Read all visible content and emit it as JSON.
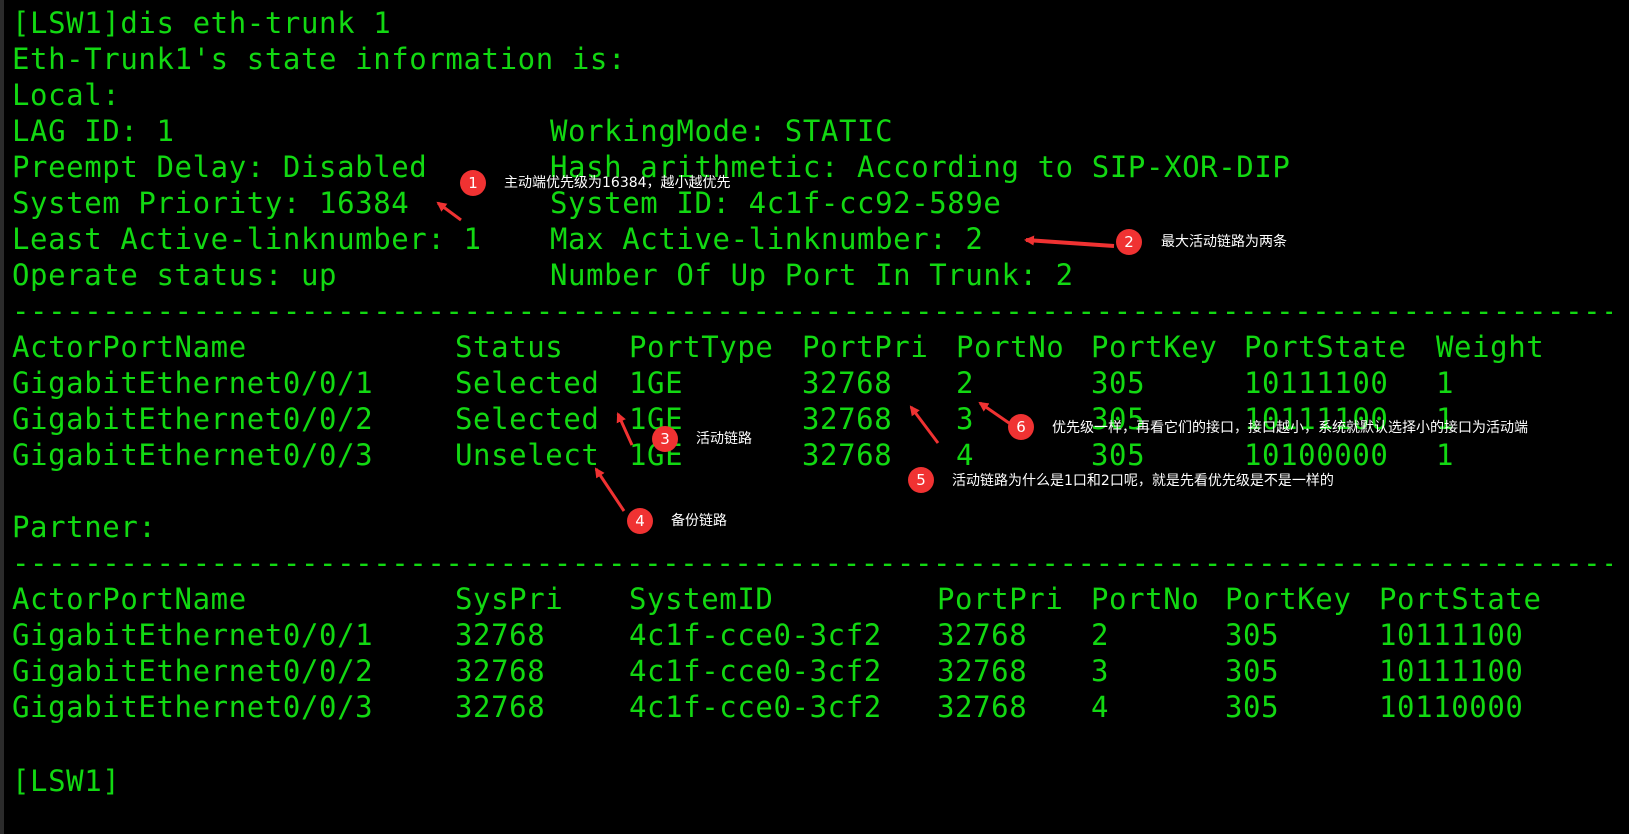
{
  "terminal": {
    "command_line": "[LSW1]dis eth-trunk 1",
    "state_title": "Eth-Trunk1's state information is:",
    "local_label": "Local:",
    "left_info": [
      "LAG ID: 1",
      "Preempt Delay: Disabled",
      "System Priority: 16384",
      "Least Active-linknumber: 1",
      "Operate status: up"
    ],
    "right_info": [
      "WorkingMode: STATIC",
      "Hash arithmetic: According to SIP-XOR-DIP",
      "System ID: 4c1f-cc92-589e",
      "Max Active-linknumber: 2",
      "Number Of Up Port In Trunk: 2"
    ],
    "separator": "--------------------------------------------------------------------------------------------------------------",
    "local_table": {
      "headers": [
        "ActorPortName",
        "Status",
        "PortType",
        "PortPri",
        "PortNo",
        "PortKey",
        "PortState",
        "Weight"
      ],
      "rows": [
        [
          "GigabitEthernet0/0/1",
          "Selected",
          "1GE",
          "32768",
          "2",
          "305",
          "10111100",
          "1"
        ],
        [
          "GigabitEthernet0/0/2",
          "Selected",
          "1GE",
          "32768",
          "3",
          "305",
          "10111100",
          "1"
        ],
        [
          "GigabitEthernet0/0/3",
          "Unselect",
          "1GE",
          "32768",
          "4",
          "305",
          "10100000",
          "1"
        ]
      ]
    },
    "partner_label": "Partner:",
    "partner_table": {
      "headers": [
        "ActorPortName",
        "SysPri",
        "SystemID",
        "PortPri",
        "PortNo",
        "PortKey",
        "PortState"
      ],
      "rows": [
        [
          "GigabitEthernet0/0/1",
          "32768",
          "4c1f-cce0-3cf2",
          "32768",
          "2",
          "305",
          "10111100"
        ],
        [
          "GigabitEthernet0/0/2",
          "32768",
          "4c1f-cce0-3cf2",
          "32768",
          "3",
          "305",
          "10111100"
        ],
        [
          "GigabitEthernet0/0/3",
          "32768",
          "4c1f-cce0-3cf2",
          "32768",
          "4",
          "305",
          "10110000"
        ]
      ]
    },
    "prompt": "[LSW1]"
  },
  "annotations": [
    {
      "number": "1",
      "text": "主动端优先级为16384，越小越优先"
    },
    {
      "number": "2",
      "text": "最大活动链路为两条"
    },
    {
      "number": "3",
      "text": "活动链路"
    },
    {
      "number": "4",
      "text": "备份链路"
    },
    {
      "number": "5",
      "text": "活动链路为什么是1口和2口呢，就是先看优先级是不是一样的"
    },
    {
      "number": "6",
      "text": "优先级一样，再看它们的接口，接口越小，系统就默认选择小的接口为活动端"
    }
  ],
  "colors": {
    "background": "#000000",
    "terminal_text": "#12d812",
    "annotation_badge": "#f03232",
    "annotation_text": "#ffffff"
  }
}
